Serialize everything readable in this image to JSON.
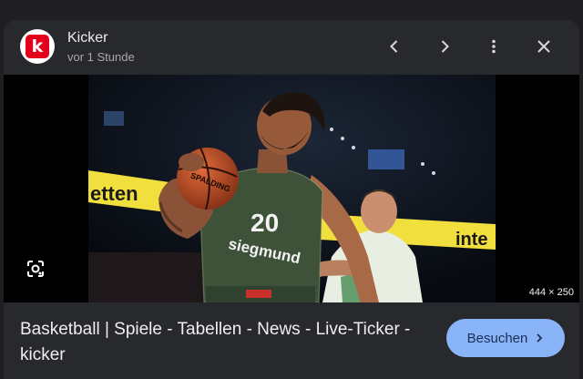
{
  "source": {
    "name": "Kicker",
    "time": "vor 1 Stunde",
    "logo_letter": "k",
    "logo_color": "#e2001a"
  },
  "header": {
    "prev_icon": "chevron-left-icon",
    "next_icon": "chevron-right-icon",
    "more_icon": "more-vert-icon",
    "close_icon": "close-icon"
  },
  "image": {
    "dimensions": "444 × 250",
    "banner_left_text": "etten",
    "banner_right_text": "inte",
    "jersey_number": "20",
    "jersey_sponsor": "siegmund",
    "ball_brand": "SPALDING"
  },
  "result": {
    "title": "Basketball | Spiele - Tabellen - News - Live-Ticker - kicker"
  },
  "actions": {
    "visit_label": "Besuchen"
  },
  "colors": {
    "accent": "#8ab4f8",
    "surface": "#28292c",
    "jersey": "#3d5238",
    "banner": "#f0df3c"
  }
}
